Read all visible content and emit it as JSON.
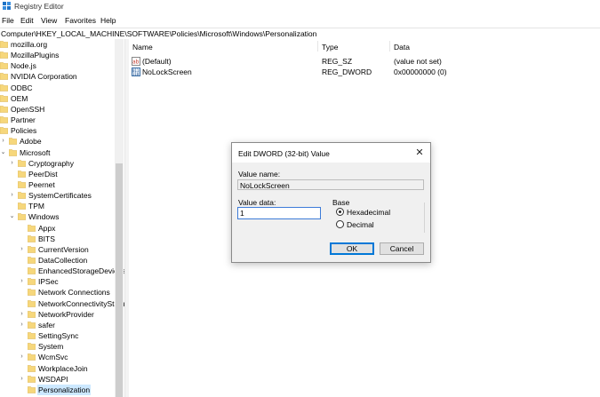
{
  "window": {
    "title": "Registry Editor"
  },
  "menu": [
    "File",
    "Edit",
    "View",
    "Favorites",
    "Help"
  ],
  "address": "Computer\\HKEY_LOCAL_MACHINE\\SOFTWARE\\Policies\\Microsoft\\Windows\\Personalization",
  "tree": [
    {
      "label": "mozilla.org",
      "level": 0,
      "expander": ""
    },
    {
      "label": "MozillaPlugins",
      "level": 0,
      "expander": ""
    },
    {
      "label": "Node.js",
      "level": 0,
      "expander": ""
    },
    {
      "label": "NVIDIA Corporation",
      "level": 0,
      "expander": ""
    },
    {
      "label": "ODBC",
      "level": 0,
      "expander": ""
    },
    {
      "label": "OEM",
      "level": 0,
      "expander": ""
    },
    {
      "label": "OpenSSH",
      "level": 0,
      "expander": ""
    },
    {
      "label": "Partner",
      "level": 0,
      "expander": ""
    },
    {
      "label": "Policies",
      "level": 0,
      "expander": ""
    },
    {
      "label": "Adobe",
      "level": 1,
      "expander": ">"
    },
    {
      "label": "Microsoft",
      "level": 1,
      "expander": "v"
    },
    {
      "label": "Cryptography",
      "level": 2,
      "expander": ">"
    },
    {
      "label": "PeerDist",
      "level": 2,
      "expander": ""
    },
    {
      "label": "Peernet",
      "level": 2,
      "expander": ""
    },
    {
      "label": "SystemCertificates",
      "level": 2,
      "expander": ">"
    },
    {
      "label": "TPM",
      "level": 2,
      "expander": ""
    },
    {
      "label": "Windows",
      "level": 2,
      "expander": "v"
    },
    {
      "label": "Appx",
      "level": 3,
      "expander": ""
    },
    {
      "label": "BITS",
      "level": 3,
      "expander": ""
    },
    {
      "label": "CurrentVersion",
      "level": 3,
      "expander": ">"
    },
    {
      "label": "DataCollection",
      "level": 3,
      "expander": ""
    },
    {
      "label": "EnhancedStorageDevices",
      "level": 3,
      "expander": ""
    },
    {
      "label": "IPSec",
      "level": 3,
      "expander": ">"
    },
    {
      "label": "Network Connections",
      "level": 3,
      "expander": ""
    },
    {
      "label": "NetworkConnectivityStatusIndicator",
      "level": 3,
      "expander": ""
    },
    {
      "label": "NetworkProvider",
      "level": 3,
      "expander": ">"
    },
    {
      "label": "safer",
      "level": 3,
      "expander": ">"
    },
    {
      "label": "SettingSync",
      "level": 3,
      "expander": ""
    },
    {
      "label": "System",
      "level": 3,
      "expander": ""
    },
    {
      "label": "WcmSvc",
      "level": 3,
      "expander": ">"
    },
    {
      "label": "WorkplaceJoin",
      "level": 3,
      "expander": ""
    },
    {
      "label": "WSDAPI",
      "level": 3,
      "expander": ">"
    },
    {
      "label": "Personalization",
      "level": 3,
      "expander": "",
      "selected": true
    }
  ],
  "list": {
    "columns": [
      "Name",
      "Type",
      "Data"
    ],
    "rows": [
      {
        "name": "(Default)",
        "type": "REG_SZ",
        "data": "(value not set)",
        "icon": "string-value-icon"
      },
      {
        "name": "NoLockScreen",
        "type": "REG_DWORD",
        "data": "0x00000000 (0)",
        "icon": "binary-value-icon"
      }
    ]
  },
  "dialog": {
    "title": "Edit DWORD (32-bit) Value",
    "value_name_label": "Value name:",
    "value_name": "NoLockScreen",
    "value_data_label": "Value data:",
    "value_data": "1",
    "base_label": "Base",
    "hex_label": "Hexadecimal",
    "dec_label": "Decimal",
    "ok_label": "OK",
    "cancel_label": "Cancel",
    "close_glyph": "✕"
  },
  "colors": {
    "folder": "#f6d77c",
    "selection": "#cce8ff",
    "accent": "#0078d7"
  }
}
